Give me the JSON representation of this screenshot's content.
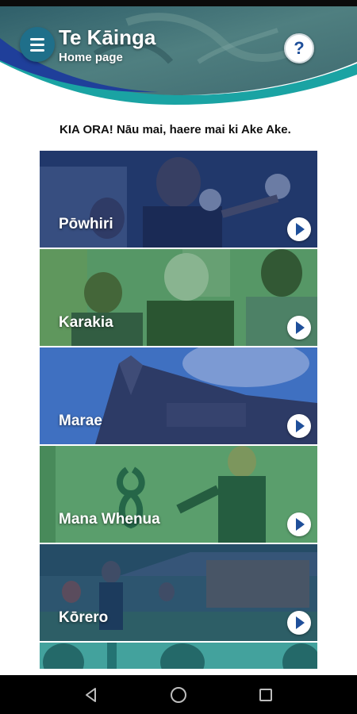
{
  "header": {
    "title": "Te Kāinga",
    "subtitle": "Home page",
    "menu_icon": "hamburger-menu-icon",
    "help_symbol": "?"
  },
  "greeting": "KIA ORA! Nāu mai, haere mai ki Ake Ake.",
  "cards": [
    {
      "label": "Pōwhiri",
      "tint": "#0d2a6b"
    },
    {
      "label": "Karakia",
      "tint": "#2a8a3a"
    },
    {
      "label": "Marae",
      "tint": "#1e4fb0"
    },
    {
      "label": "Mana Whenua",
      "tint": "#1e8a5a"
    },
    {
      "label": "Kōrero",
      "tint": "#1e4f8a"
    }
  ],
  "colors": {
    "accent_blue": "#1f4f9a",
    "header_teal": "#1f6f8a",
    "wave_teal": "#1aa3a3"
  },
  "nav": {
    "back_icon": "back-triangle-icon",
    "home_icon": "home-circle-icon",
    "recents_icon": "recents-square-icon"
  }
}
